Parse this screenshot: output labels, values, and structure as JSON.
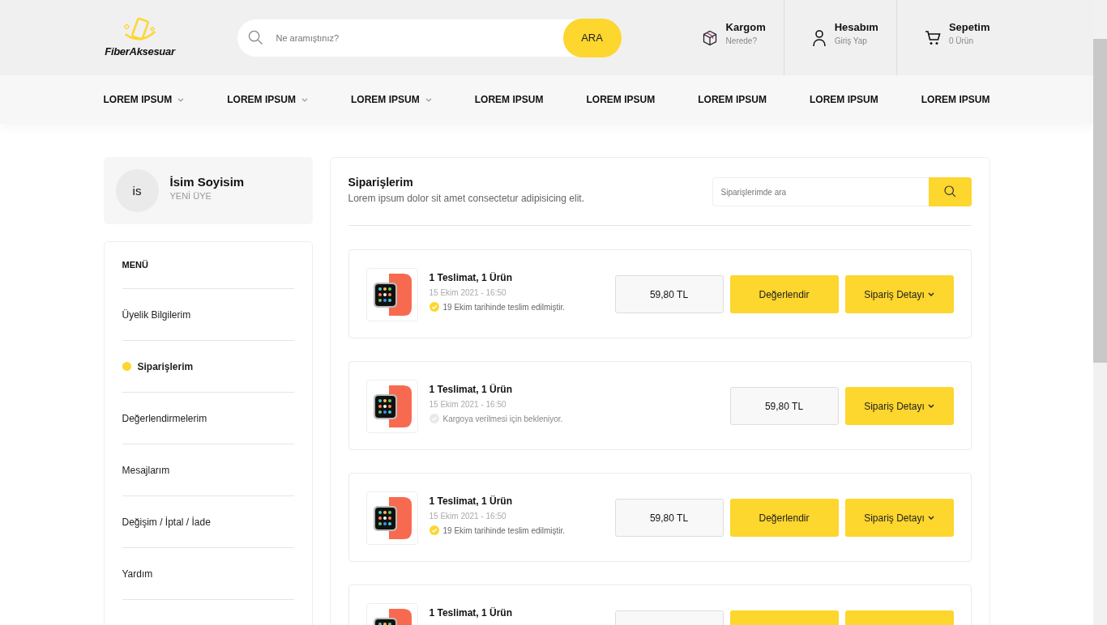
{
  "header": {
    "logo": "FiberAksesuar",
    "search": {
      "placeholder": "Ne aramıştınız?",
      "button": "ARA"
    },
    "actions": [
      {
        "kind": "cargo",
        "title": "Kargom",
        "subtitle": "Nerede?"
      },
      {
        "kind": "account",
        "title": "Hesabım",
        "subtitle": "Giriş Yap"
      },
      {
        "kind": "cart",
        "title": "Sepetim",
        "subtitle": "0 Ürün"
      }
    ]
  },
  "nav": [
    {
      "label": "LOREM IPSUM",
      "dropdown": true
    },
    {
      "label": "LOREM IPSUM",
      "dropdown": true
    },
    {
      "label": "LOREM IPSUM",
      "dropdown": true
    },
    {
      "label": "LOREM IPSUM",
      "dropdown": false
    },
    {
      "label": "LOREM IPSUM",
      "dropdown": false
    },
    {
      "label": "LOREM IPSUM",
      "dropdown": false
    },
    {
      "label": "LOREM IPSUM",
      "dropdown": false
    },
    {
      "label": "LOREM IPSUM",
      "dropdown": false
    }
  ],
  "profile": {
    "initials": "is",
    "name": "İsim Soyisim",
    "status": "YENİ ÜYE"
  },
  "menu": {
    "title": "MENÜ",
    "items": [
      {
        "label": "Üyelik Bilgilerim",
        "selected": false
      },
      {
        "label": "Siparişlerim",
        "selected": true
      },
      {
        "label": "Değerlendirmelerim",
        "selected": false
      },
      {
        "label": "Mesajlarım",
        "selected": false
      },
      {
        "label": "Değişim / İptal / İade",
        "selected": false
      },
      {
        "label": "Yardım",
        "selected": false
      }
    ]
  },
  "orders_panel": {
    "title": "Siparişlerim",
    "subtitle": "Lorem ipsum dolor sit amet consectetur adipisicing elit.",
    "search_placeholder": "Siparişlerimde ara",
    "orders": [
      {
        "title": "1 Teslimat, 1 Ürün",
        "date": "15 Ekim 2021 - 16:50",
        "status": "19 Ekim tarihinde teslim edilmiştir.",
        "delivered": true,
        "price": "59,80 TL",
        "rate_button": "Değerlendir",
        "detail_button": "Sipariş Detayı"
      },
      {
        "title": "1 Teslimat, 1 Ürün",
        "date": "15 Ekim 2021 - 16:50",
        "status": "Kargoya verilmesi için bekleniyor.",
        "delivered": false,
        "price": "59,80 TL",
        "detail_button": "Sipariş Detayı"
      },
      {
        "title": "1 Teslimat, 1 Ürün",
        "date": "15 Ekim 2021 - 16:50",
        "status": "19 Ekim tarihinde teslim edilmiştir.",
        "delivered": true,
        "price": "59,80 TL",
        "rate_button": "Değerlendir",
        "detail_button": "Sipariş Detayı"
      },
      {
        "title": "1 Teslimat, 1 Ürün"
      }
    ]
  }
}
